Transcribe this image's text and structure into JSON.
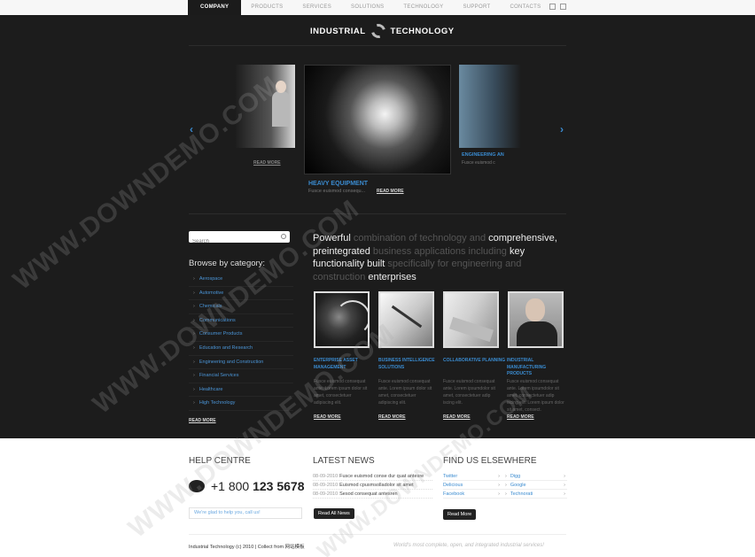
{
  "nav": {
    "items": [
      "Company",
      "Products",
      "Services",
      "Solutions",
      "Technology",
      "Support",
      "Contacts"
    ],
    "active_index": 0
  },
  "logo": {
    "left": "INDUSTRIAL",
    "right": "TECHNOLOGY"
  },
  "slider": {
    "prev_read_more": "READ MORE",
    "center_title": "HEAVY EQUIPMENT",
    "center_text": "Fusce euismod consequ...",
    "center_read_more": "READ MORE",
    "right_title": "ENGINEERING AN",
    "right_text": "Fusce euismod c"
  },
  "search": {
    "placeholder": "Search"
  },
  "browse": {
    "title": "Browse by category:",
    "categories": [
      "Aerospace",
      "Automotive",
      "Chemicals",
      "Communications",
      "Consumer Products",
      "Education and Research",
      "Engineering and Construction",
      "Financial Services",
      "Healthcare",
      "High Technology"
    ],
    "read_more": "READ MORE"
  },
  "headline": {
    "p1": "Powerful",
    "p2": " combination of technology and ",
    "p3": "comprehensive, preintegrated",
    "p4": " business applications including ",
    "p5": "key functionality built",
    "p6": " specifically for engineering and construction ",
    "p7": "enterprises"
  },
  "products": [
    {
      "title": "ENTERPRISE ASSET MANAGEMENT",
      "text": "Fusce euismod consequat ante. Lorem ipsum dolor sit amet, consectetuer adipiscing elit.",
      "link": "READ MORE"
    },
    {
      "title": "BUSINESS INTELLIGENCE SOLUTIONS",
      "text": "Fusce euismod consequat ante. Lorem ipsum dolor sit amet, consectetuer adipiscing elit.",
      "link": "READ MORE"
    },
    {
      "title": "COLLABORATIVE PLANNING",
      "text": "Fusce euismod consequat ante. Lorem ipsumdolor sit amet, consectetuer adip iscing elit.",
      "link": "READ MORE"
    },
    {
      "title": "INDUSTRIAL MANUFACTURING PRODUCTS",
      "text": "Fusce euismod consequat ante. Lorem ipsumdolor sit amet, consectetuer adip iscing elit. Lorem ipsum dolor sit amet, consect.",
      "link": "READ MORE"
    }
  ],
  "help": {
    "title": "HELP CENTRE",
    "phone_prefix": "+1 800",
    "phone_number": "123 5678",
    "input_text": "We're glad to help you, call us!"
  },
  "news": {
    "title": "LATEST NEWS",
    "items": [
      {
        "date": "08-09-2010",
        "text": "Fusce euismod conse dur quat antesre"
      },
      {
        "date": "08-09-2010",
        "text": "Euismod cpusmsolladolor sit amet"
      },
      {
        "date": "08-09-2010",
        "text": "Sesod consequat antesren"
      }
    ],
    "button": "Read All News"
  },
  "elsewhere": {
    "title": "FIND US ELSEWHERE",
    "left": [
      "Twitter",
      "Delicious",
      "Facebook"
    ],
    "right": [
      "Digg",
      "Google",
      "Technorati"
    ],
    "button": "Read More"
  },
  "footer": {
    "left": "Industrial Technology (c) 2010  |  Collect from 网站模板",
    "right": "World's most complete, open, and integrated industrial services!"
  },
  "watermark": "WWW.DOWNDEMO.COM",
  "colors": {
    "accent": "#3a8bd0",
    "dark_bg": "#1c1c1c",
    "light_bg": "#ffffff"
  }
}
